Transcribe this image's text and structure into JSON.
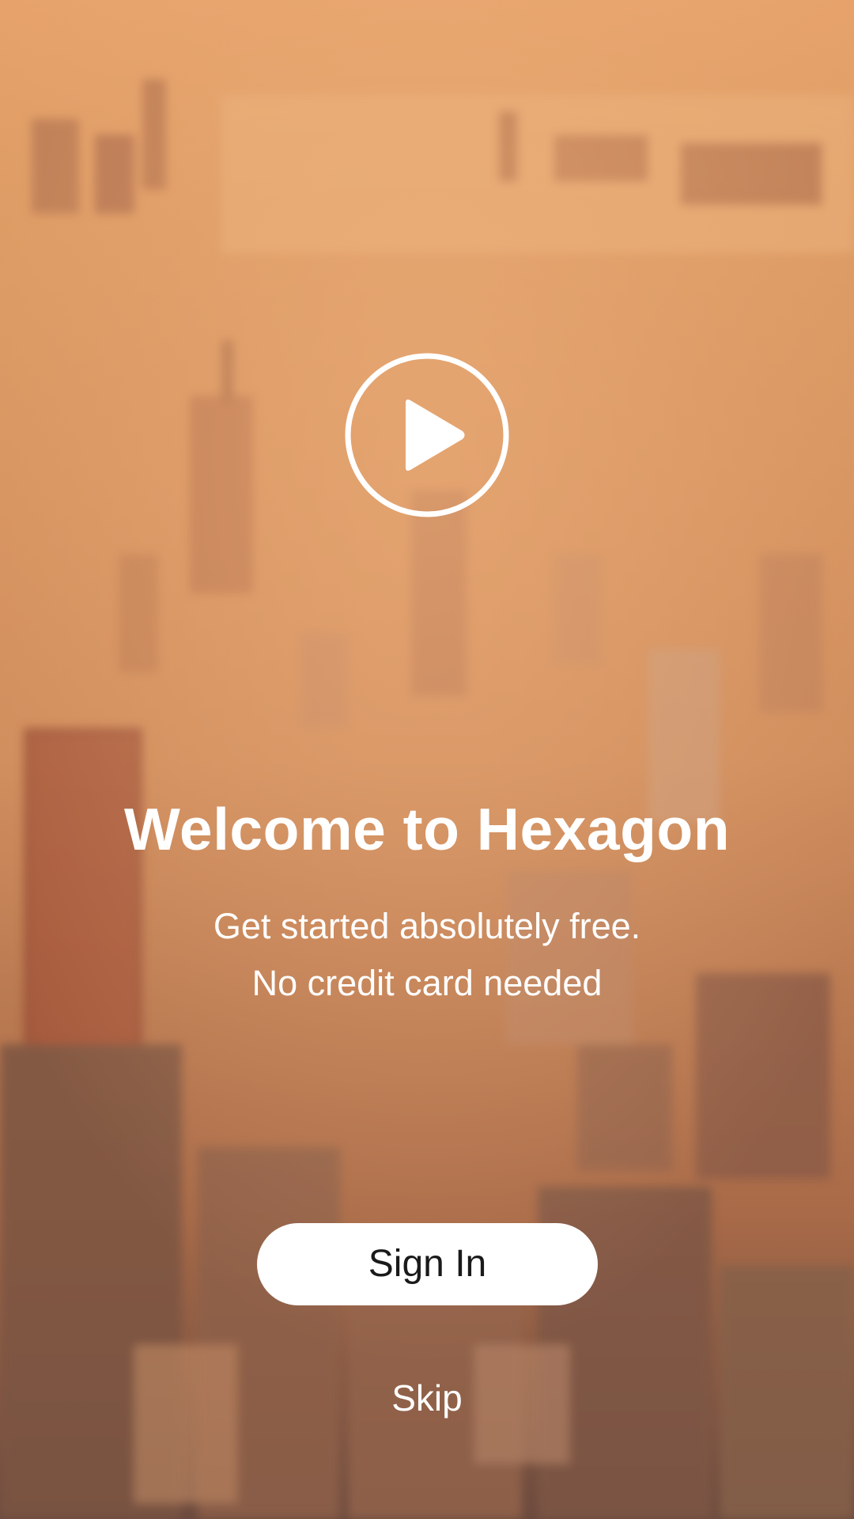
{
  "background": {
    "description_icon": "city-skyline-photo",
    "tint_color": "#d48f5a"
  },
  "hero": {
    "play_icon": "play-icon",
    "title": "Welcome to Hexagon",
    "subtitle_line1": "Get started absolutely free.",
    "subtitle_line2": "No credit card needed"
  },
  "actions": {
    "signin_label": "Sign In",
    "skip_label": "Skip"
  },
  "colors": {
    "text": "#ffffff",
    "button_bg": "#ffffff",
    "button_text": "#1a1a1a"
  }
}
